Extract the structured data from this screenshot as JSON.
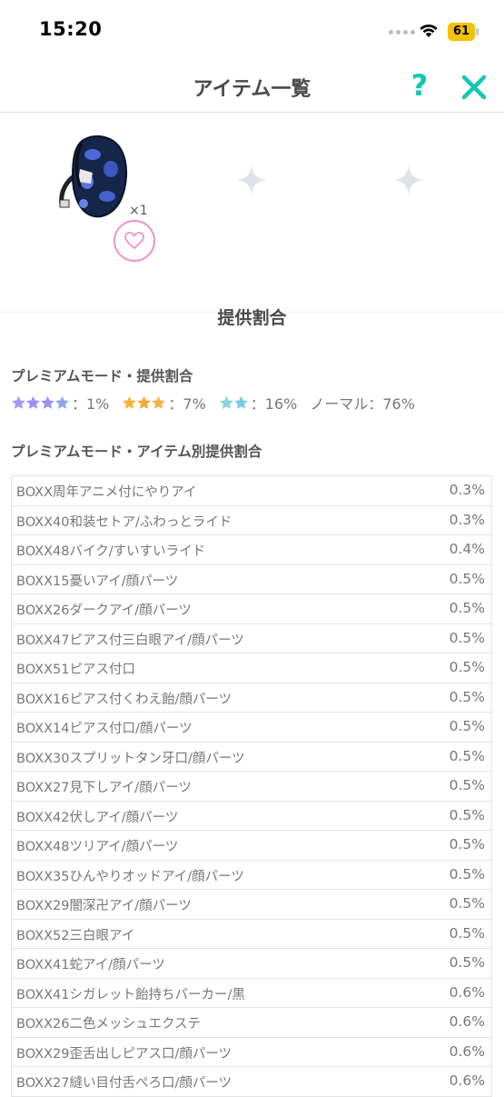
{
  "status_bar": {
    "time": "15:20",
    "battery": "61"
  },
  "header": {
    "title": "アイテム一覧"
  },
  "slots": {
    "quantity": "×1"
  },
  "section": {
    "title": "提供割合"
  },
  "premium": {
    "title": "プレミアムモード・提供割合",
    "rates": [
      {
        "stars": 4,
        "color": "#9d8ff5",
        "value": "：1%"
      },
      {
        "stars": 3,
        "color": "#f7ae3b",
        "value": "：7%"
      },
      {
        "stars": 2,
        "color": "#7fd4e0",
        "value": "：16%"
      }
    ],
    "normal": "ノーマル：76%"
  },
  "item_rates": {
    "title": "プレミアムモード・アイテム別提供割合",
    "rows": [
      {
        "name": "BOXX周年アニメ付にやりアイ",
        "rate": "0.3%"
      },
      {
        "name": "BOXX40和装セトア/ふわっとライド",
        "rate": "0.3%"
      },
      {
        "name": "BOXX48バイク/すいすいライド",
        "rate": "0.4%"
      },
      {
        "name": "BOXX15憂いアイ/顔パーツ",
        "rate": "0.5%"
      },
      {
        "name": "BOXX26ダークアイ/顔パーツ",
        "rate": "0.5%"
      },
      {
        "name": "BOXX47ピアス付三白眼アイ/顔パーツ",
        "rate": "0.5%"
      },
      {
        "name": "BOXX51ピアス付口",
        "rate": "0.5%"
      },
      {
        "name": "BOXX16ピアス付くわえ飴/顔パーツ",
        "rate": "0.5%"
      },
      {
        "name": "BOXX14ピアス付口/顔パーツ",
        "rate": "0.5%"
      },
      {
        "name": "BOXX30スプリットタン牙口/顔パーツ",
        "rate": "0.5%"
      },
      {
        "name": "BOXX27見下しアイ/顔パーツ",
        "rate": "0.5%"
      },
      {
        "name": "BOXX42伏しアイ/顔パーツ",
        "rate": "0.5%"
      },
      {
        "name": "BOXX48ツリアイ/顔パーツ",
        "rate": "0.5%"
      },
      {
        "name": "BOXX35ひんやりオッドアイ/顔パーツ",
        "rate": "0.5%"
      },
      {
        "name": "BOXX29闇深卍アイ/顔パーツ",
        "rate": "0.5%"
      },
      {
        "name": "BOXX52三白眼アイ",
        "rate": "0.5%"
      },
      {
        "name": "BOXX41蛇アイ/顔パーツ",
        "rate": "0.5%"
      },
      {
        "name": "BOXX41シガレット飴持ちパーカー/黒",
        "rate": "0.6%"
      },
      {
        "name": "BOXX26二色メッシュエクステ",
        "rate": "0.6%"
      },
      {
        "name": "BOXX29歪舌出しピアス口/顔パーツ",
        "rate": "0.6%"
      },
      {
        "name": "BOXX27縫い目付舌ぺろ口/顔パーツ",
        "rate": "0.6%"
      }
    ]
  },
  "icons": [
    "wifi-icon",
    "help-icon",
    "close-icon",
    "backpack-icon",
    "heart-icon",
    "sparkle-placeholder-icon",
    "star-icon"
  ],
  "colors": {
    "accent": "#12c8b4",
    "heart": "#f291c8",
    "battery": "#f2c200"
  }
}
